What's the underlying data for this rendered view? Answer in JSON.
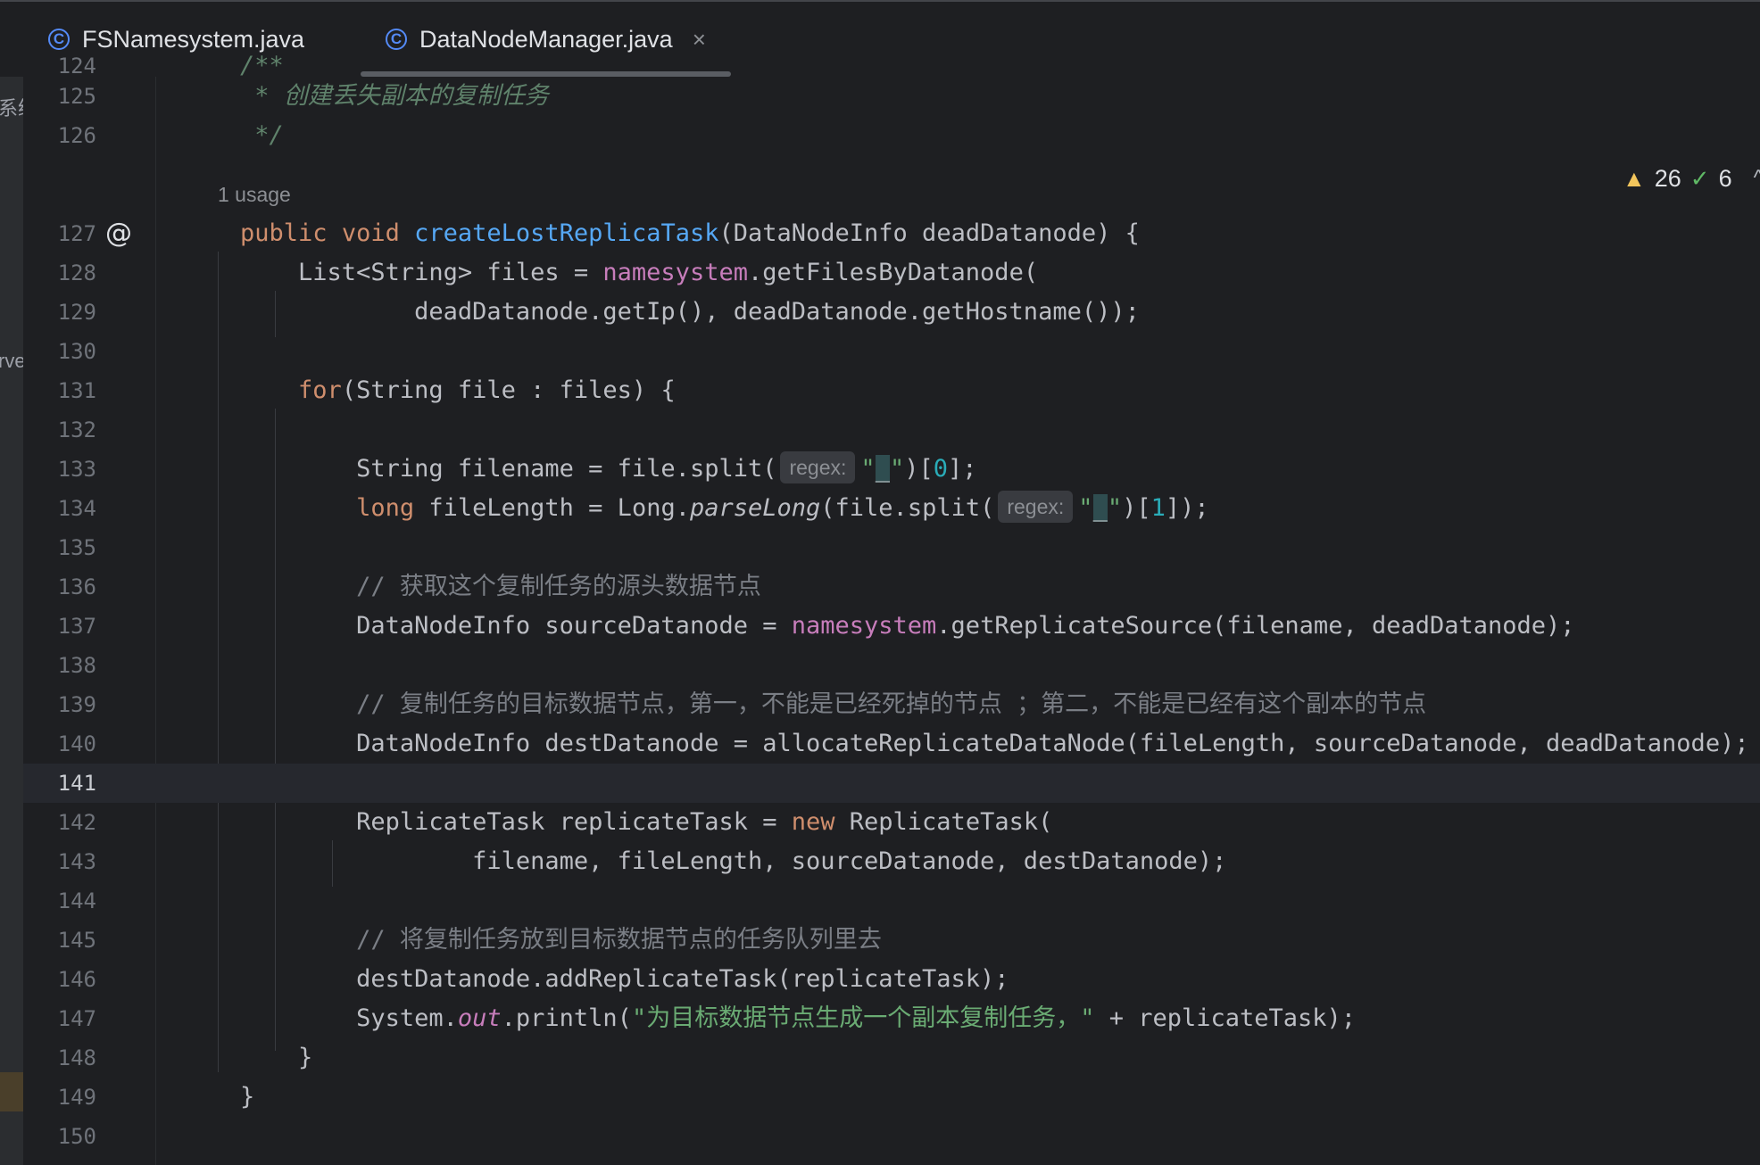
{
  "tabs": [
    {
      "label": "FSNamesystem.java",
      "icon": "class-icon",
      "active": false
    },
    {
      "label": "DataNodeManager.java",
      "icon": "class-icon",
      "active": true,
      "close": "×"
    }
  ],
  "class_icon_glyph": "C",
  "left_strip": {
    "top_text": "系统",
    "mid_text": "rve"
  },
  "inspection": {
    "warnings": "26",
    "weak_warnings": "6"
  },
  "editor": {
    "usage_hint": "1 usage",
    "gutter_at": "@",
    "lines": [
      {
        "n": "124",
        "tokens": [
          {
            "t": "    /**",
            "c": "doc"
          }
        ]
      },
      {
        "n": "125",
        "tokens": [
          {
            "t": "     * 创建丢失副本的复制任务",
            "c": "doc"
          }
        ]
      },
      {
        "n": "126",
        "tokens": [
          {
            "t": "     */",
            "c": "doc"
          }
        ]
      },
      {
        "n": "127",
        "tokens": [
          {
            "t": "    ",
            "c": ""
          },
          {
            "t": "public void ",
            "c": "kw"
          },
          {
            "t": "createLostReplicaTask",
            "c": "fn"
          },
          {
            "t": "(DataNodeInfo deadDatanode) {",
            "c": ""
          }
        ]
      },
      {
        "n": "128",
        "tokens": [
          {
            "t": "        List<String> files = ",
            "c": ""
          },
          {
            "t": "namesystem",
            "c": "field"
          },
          {
            "t": ".getFilesByDatanode(",
            "c": ""
          }
        ]
      },
      {
        "n": "129",
        "tokens": [
          {
            "t": "                deadDatanode.getIp(), deadDatanode.getHostname());",
            "c": ""
          }
        ]
      },
      {
        "n": "130",
        "tokens": []
      },
      {
        "n": "131",
        "tokens": [
          {
            "t": "        ",
            "c": ""
          },
          {
            "t": "for",
            "c": "kw"
          },
          {
            "t": "(String file : files) {",
            "c": ""
          }
        ]
      },
      {
        "n": "132",
        "tokens": []
      },
      {
        "n": "133",
        "tokens": [
          {
            "t": "            String filename = file.split(",
            "c": ""
          },
          {
            "t": "regex:",
            "c": "hint"
          },
          {
            "t": "\"",
            "c": "str"
          },
          {
            "t": "_",
            "c": "caret-char"
          },
          {
            "t": "\"",
            "c": "str"
          },
          {
            "t": ")[",
            "c": ""
          },
          {
            "t": "0",
            "c": "num"
          },
          {
            "t": "];",
            "c": ""
          }
        ]
      },
      {
        "n": "134",
        "tokens": [
          {
            "t": "            ",
            "c": ""
          },
          {
            "t": "long",
            "c": "kw"
          },
          {
            "t": " fileLength = Long.",
            "c": ""
          },
          {
            "t": "parseLong",
            "c": "italic"
          },
          {
            "t": "(file.split(",
            "c": ""
          },
          {
            "t": "regex:",
            "c": "hint"
          },
          {
            "t": "\"",
            "c": "str"
          },
          {
            "t": "_",
            "c": "caret-char"
          },
          {
            "t": "\"",
            "c": "str"
          },
          {
            "t": ")[",
            "c": ""
          },
          {
            "t": "1",
            "c": "num"
          },
          {
            "t": "]);",
            "c": ""
          }
        ]
      },
      {
        "n": "135",
        "tokens": []
      },
      {
        "n": "136",
        "tokens": [
          {
            "t": "            // 获取这个复制任务的源头数据节点",
            "c": "cmt"
          }
        ]
      },
      {
        "n": "137",
        "tokens": [
          {
            "t": "            DataNodeInfo sourceDatanode = ",
            "c": ""
          },
          {
            "t": "namesystem",
            "c": "field"
          },
          {
            "t": ".getReplicateSource(filename, deadDatanode);",
            "c": ""
          }
        ]
      },
      {
        "n": "138",
        "tokens": []
      },
      {
        "n": "139",
        "tokens": [
          {
            "t": "            // 复制任务的目标数据节点，第一，不能是已经死掉的节点 ；第二，不能是已经有这个副本的节点",
            "c": "cmt"
          }
        ]
      },
      {
        "n": "140",
        "tokens": [
          {
            "t": "            DataNodeInfo destDatanode = allocateReplicateDataNode(fileLength, sourceDatanode, deadDatanode);",
            "c": ""
          }
        ]
      },
      {
        "n": "141",
        "tokens": [],
        "current": true
      },
      {
        "n": "142",
        "tokens": [
          {
            "t": "            ReplicateTask replicateTask = ",
            "c": ""
          },
          {
            "t": "new",
            "c": "kw"
          },
          {
            "t": " ReplicateTask(",
            "c": ""
          }
        ]
      },
      {
        "n": "143",
        "tokens": [
          {
            "t": "                    filename, fileLength, sourceDatanode, destDatanode);",
            "c": ""
          }
        ]
      },
      {
        "n": "144",
        "tokens": []
      },
      {
        "n": "145",
        "tokens": [
          {
            "t": "            // 将复制任务放到目标数据节点的任务队列里去",
            "c": "cmt"
          }
        ]
      },
      {
        "n": "146",
        "tokens": [
          {
            "t": "            destDatanode.addReplicateTask(replicateTask);",
            "c": ""
          }
        ]
      },
      {
        "n": "147",
        "tokens": [
          {
            "t": "            System.",
            "c": ""
          },
          {
            "t": "out",
            "c": "static"
          },
          {
            "t": ".println(",
            "c": ""
          },
          {
            "t": "\"为目标数据节点生成一个副本复制任务，\"",
            "c": "str"
          },
          {
            "t": " + replicateTask);",
            "c": ""
          }
        ]
      },
      {
        "n": "148",
        "tokens": [
          {
            "t": "        }",
            "c": ""
          }
        ]
      },
      {
        "n": "149",
        "tokens": [
          {
            "t": "    }",
            "c": ""
          }
        ]
      },
      {
        "n": "150",
        "tokens": []
      }
    ]
  }
}
